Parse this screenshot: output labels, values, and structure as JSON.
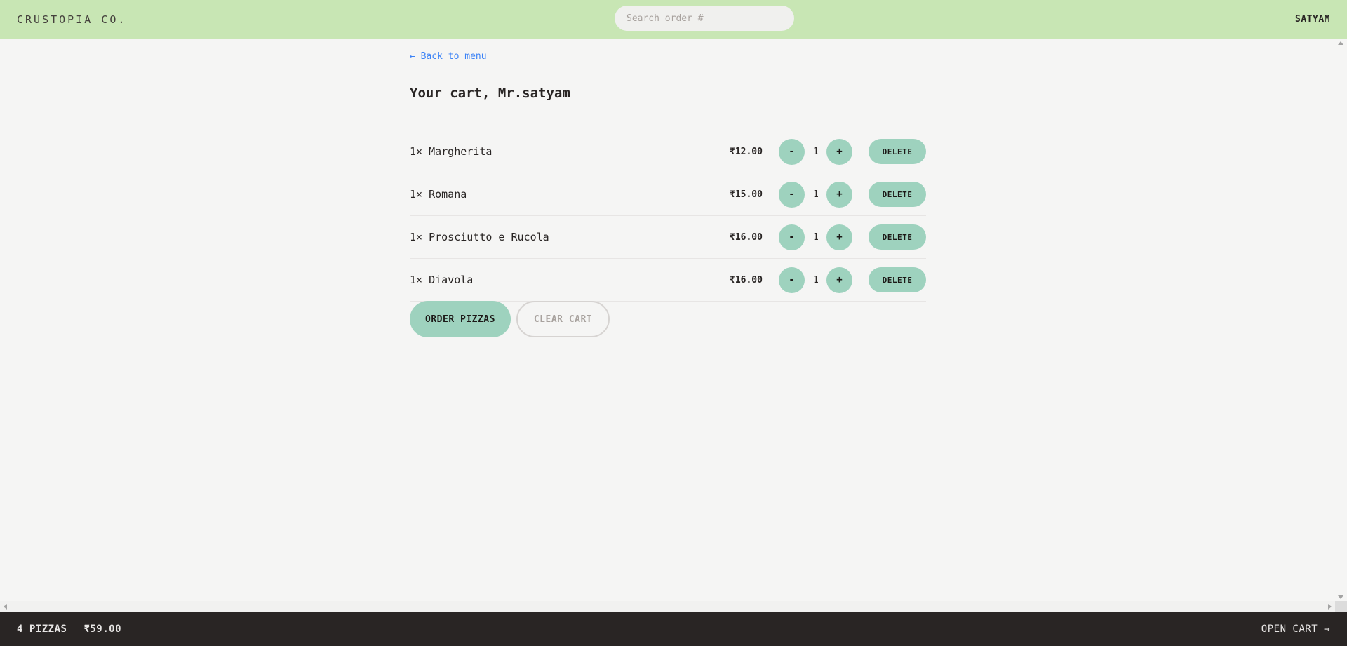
{
  "header": {
    "logo": "CRUSTOPIA CO.",
    "search_placeholder": "Search order #",
    "username": "SATYAM"
  },
  "main": {
    "back_link": "← Back to menu",
    "title": "Your cart, Mr.satyam",
    "items": [
      {
        "name": "1× Margherita",
        "price": "₹12.00",
        "quantity": "1"
      },
      {
        "name": "1× Romana",
        "price": "₹15.00",
        "quantity": "1"
      },
      {
        "name": "1× Prosciutto e Rucola",
        "price": "₹16.00",
        "quantity": "1"
      },
      {
        "name": "1× Diavola",
        "price": "₹16.00",
        "quantity": "1"
      }
    ],
    "minus_label": "-",
    "plus_label": "+",
    "delete_label": "DELETE",
    "order_label": "ORDER PIZZAS",
    "clear_label": "CLEAR CART"
  },
  "footer": {
    "pizza_count": "4 PIZZAS",
    "total": "₹59.00",
    "open_cart": "OPEN CART →"
  },
  "colors": {
    "header_bg": "#c8e6b4",
    "button_bg": "#9ed2be",
    "footer_bg": "#292524",
    "link": "#3b82f6"
  }
}
